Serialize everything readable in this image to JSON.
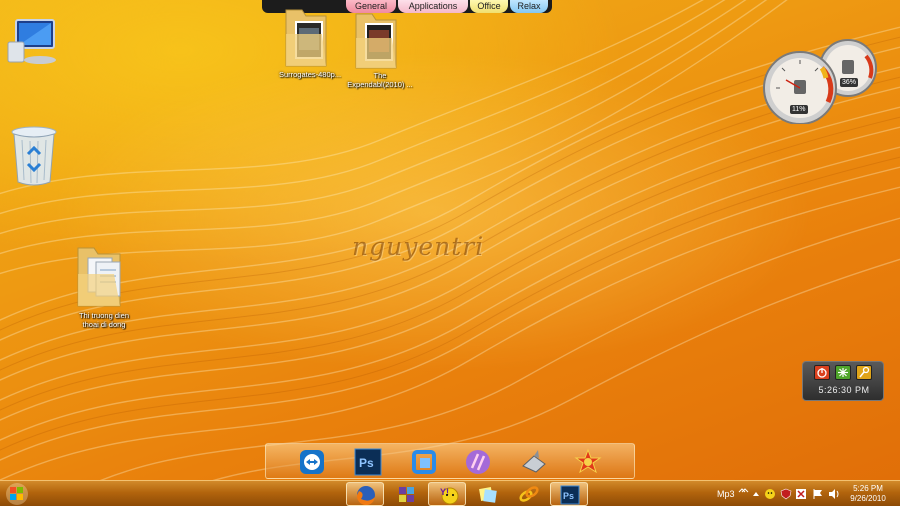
{
  "launcher_tabs": [
    "General",
    "Applications",
    "Office",
    "Relax"
  ],
  "desktop_icons": {
    "computer": "Computer",
    "recycle_bin": "Recycle Bin",
    "folder_1": "Surrogates-480p...",
    "folder_2_line1": "The",
    "folder_2_line2": "Expendabl(2010) ...",
    "folder_3_line1": "Thi truong dien",
    "folder_3_line2": "thoai di dong"
  },
  "watermark": "nguyentri",
  "gauges": {
    "cpu": "11%",
    "memory": "36%"
  },
  "clock_gadget": {
    "time": "5:26:30 PM"
  },
  "dock_apps": [
    "teamviewer-icon",
    "photoshop-icon",
    "app-blue-icon",
    "app-purple-icon",
    "game-ship-icon",
    "game-star-icon"
  ],
  "taskbar": {
    "apps": [
      "firefox-icon",
      "yahoo-grid-icon",
      "yahoo-messenger-icon",
      "notes-icon",
      "link-icon",
      "photoshop-icon"
    ],
    "mp3_label": "Mp3",
    "clock_time": "5:26 PM",
    "clock_date": "9/26/2010"
  },
  "colors": {
    "desktop_base": "#ee9a12",
    "taskbar": "#b3650d"
  }
}
